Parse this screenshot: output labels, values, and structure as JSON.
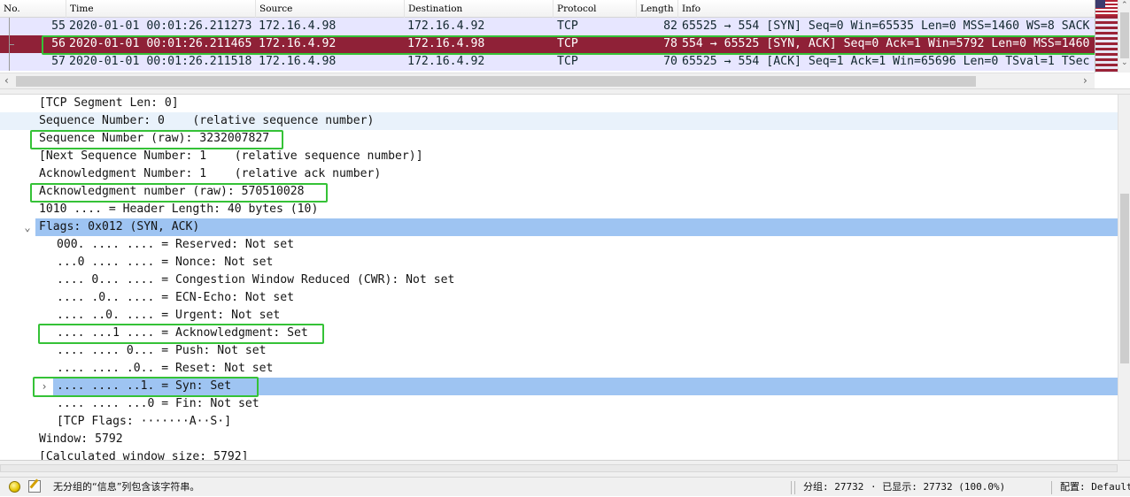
{
  "packet_list": {
    "columns": [
      "No.",
      "Time",
      "Source",
      "Destination",
      "Protocol",
      "Length",
      "Info"
    ],
    "rows": [
      {
        "no": "55",
        "time": "2020-01-01 00:01:26.211273",
        "source": "172.16.4.98",
        "destination": "172.16.4.92",
        "protocol": "TCP",
        "length": "82",
        "info": "65525 → 554 [SYN] Seq=0 Win=65535 Len=0 MSS=1460 WS=8 SACK"
      },
      {
        "no": "56",
        "time": "2020-01-01 00:01:26.211465",
        "source": "172.16.4.92",
        "destination": "172.16.4.98",
        "protocol": "TCP",
        "length": "78",
        "info": "554 → 65525 [SYN, ACK] Seq=0 Ack=1 Win=5792 Len=0 MSS=1460"
      },
      {
        "no": "57",
        "time": "2020-01-01 00:01:26.211518",
        "source": "172.16.4.98",
        "destination": "172.16.4.92",
        "protocol": "TCP",
        "length": "70",
        "info": "65525 → 554 [ACK] Seq=1 Ack=1 Win=65696 Len=0 TSval=1 TSec"
      }
    ],
    "selected_row": "56",
    "colors": {
      "normal_bg": "#e7e6ff",
      "selected_bg": "#8f2137",
      "selected_fg": "#ffffff"
    }
  },
  "details": {
    "lines": [
      "[TCP Segment Len: 0]",
      "Sequence Number: 0    (relative sequence number)",
      "Sequence Number (raw): 3232007827",
      "[Next Sequence Number: 1    (relative sequence number)]",
      "Acknowledgment Number: 1    (relative ack number)",
      "Acknowledgment number (raw): 570510028",
      "1010 .... = Header Length: 40 bytes (10)",
      "Flags: 0x012 (SYN, ACK)",
      "000. .... .... = Reserved: Not set",
      "...0 .... .... = Nonce: Not set",
      ".... 0... .... = Congestion Window Reduced (CWR): Not set",
      ".... .0.. .... = ECN-Echo: Not set",
      ".... ..0. .... = Urgent: Not set",
      ".... ...1 .... = Acknowledgment: Set",
      ".... .... 0... = Push: Not set",
      ".... .... .0.. = Reset: Not set",
      ".... .... ..1. = Syn: Set",
      ".... .... ...0 = Fin: Not set",
      "[TCP Flags: ·······A··S·]",
      "Window: 5792",
      "[Calculated window size: 5792]"
    ],
    "flags_expander": "⌄",
    "syn_expander": "›",
    "colors": {
      "selected_bg": "#9ec4f2",
      "hover_bg": "#e9f2fb",
      "annotation_box": "#35c237"
    }
  },
  "status_bar": {
    "message": "无分组的“信息”列包含该字符串。",
    "packets": "分组: 27732",
    "displayed": "· 已显示: 27732 (100.0%)",
    "profile": "配置: Default"
  },
  "icons": {
    "expert_info": "expert-info-icon",
    "comment": "comment-icon"
  }
}
